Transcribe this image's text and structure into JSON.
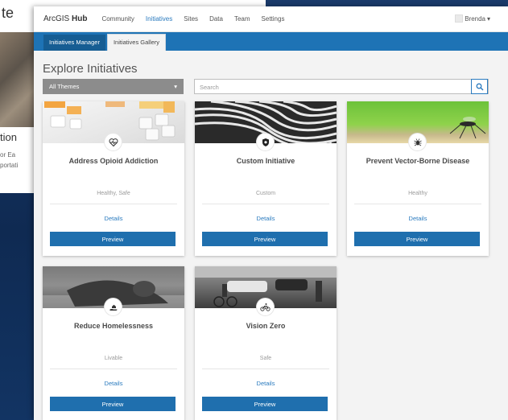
{
  "background_page": {
    "title_fragment": "te",
    "subtitle_fragment": "tion",
    "text_fragments": [
      "or Ea",
      "portati"
    ]
  },
  "app": {
    "brand_light": "ArcGIS",
    "brand_bold": " Hub",
    "nav": [
      "Community",
      "Initiatives",
      "Sites",
      "Data",
      "Team",
      "Settings"
    ],
    "active_nav": "Initiatives",
    "user_name": "Brenda",
    "user_caret": "▾"
  },
  "subnav": {
    "tabs": [
      "Initiatives Manager",
      "Initiatives Gallery"
    ],
    "active": "Initiatives Gallery"
  },
  "main": {
    "title": "Explore Initiatives",
    "theme_select": "All Themes",
    "theme_caret": "▾",
    "search_placeholder": "Search"
  },
  "cards": [
    {
      "title": "Address Opioid Addiction",
      "tags": "Healthy, Safe",
      "details": "Details",
      "preview": "Preview",
      "icon": "heart-pulse-icon"
    },
    {
      "title": "Custom Initiative",
      "tags": "Custom",
      "details": "Details",
      "preview": "Preview",
      "icon": "shield-icon"
    },
    {
      "title": "Prevent Vector-Borne Disease",
      "tags": "Healthy",
      "details": "Details",
      "preview": "Preview",
      "icon": "bug-icon"
    },
    {
      "title": "Reduce Homelessness",
      "tags": "Livable",
      "details": "Details",
      "preview": "Preview",
      "icon": "hand-house-icon"
    },
    {
      "title": "Vision Zero",
      "tags": "Safe",
      "details": "Details",
      "preview": "Preview",
      "icon": "bicycle-icon"
    }
  ],
  "colors": {
    "accent": "#2b7bbf",
    "subnav_bar": "#1e73b5",
    "preview_button": "#1f6fae",
    "background": "#1a3a6a"
  }
}
